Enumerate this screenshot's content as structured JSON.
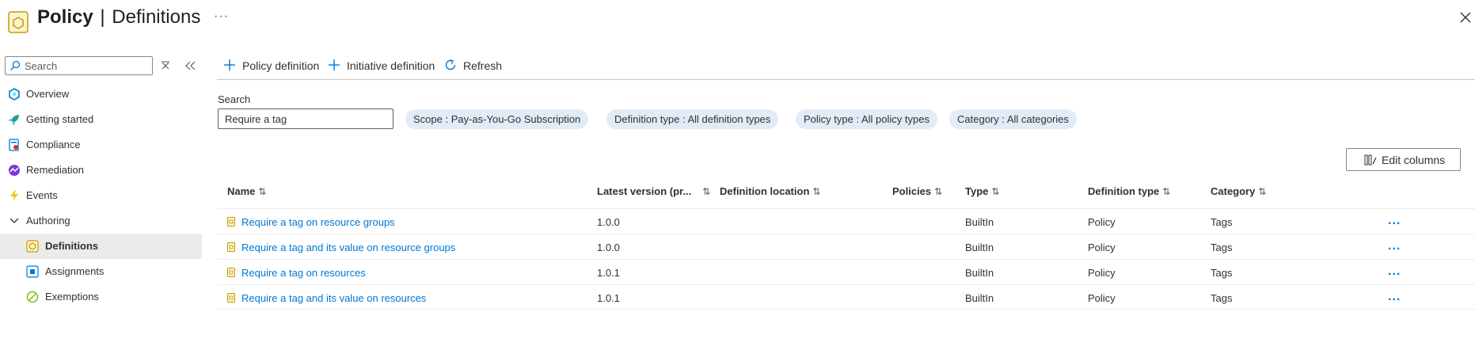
{
  "header": {
    "title_bold": "Policy",
    "separator": "|",
    "title_rest": "Definitions",
    "more": "···"
  },
  "sidebar": {
    "search_placeholder": "Search",
    "items": [
      {
        "label": "Overview",
        "icon": "overview-icon"
      },
      {
        "label": "Getting started",
        "icon": "rocket-icon"
      },
      {
        "label": "Compliance",
        "icon": "compliance-icon"
      },
      {
        "label": "Remediation",
        "icon": "remediation-icon"
      },
      {
        "label": "Events",
        "icon": "lightning-icon"
      },
      {
        "label": "Authoring",
        "icon": "chevron-down-icon"
      },
      {
        "label": "Definitions",
        "icon": "definitions-icon"
      },
      {
        "label": "Assignments",
        "icon": "assignments-icon"
      },
      {
        "label": "Exemptions",
        "icon": "exemptions-icon"
      }
    ]
  },
  "toolbar": {
    "policy_definition": "Policy definition",
    "initiative_definition": "Initiative definition",
    "refresh": "Refresh"
  },
  "filters": {
    "search_label": "Search",
    "search_value": "Require a tag",
    "scope": "Scope : Pay-as-You-Go Subscription",
    "definition_type": "Definition type : All definition types",
    "policy_type": "Policy type : All policy types",
    "category": "Category : All categories"
  },
  "edit_columns": "Edit columns",
  "table": {
    "columns": [
      "Name",
      "Latest version (pr...",
      "Definition location",
      "Policies",
      "Type",
      "Definition type",
      "Category"
    ],
    "sort_glyph": "⇅",
    "more_glyph": "...",
    "rows": [
      {
        "name": "Require a tag on resource groups",
        "version": "1.0.0",
        "location": "",
        "policies": "",
        "type": "BuiltIn",
        "definition_type": "Policy",
        "category": "Tags"
      },
      {
        "name": "Require a tag and its value on resource groups",
        "version": "1.0.0",
        "location": "",
        "policies": "",
        "type": "BuiltIn",
        "definition_type": "Policy",
        "category": "Tags"
      },
      {
        "name": "Require a tag on resources",
        "version": "1.0.1",
        "location": "",
        "policies": "",
        "type": "BuiltIn",
        "definition_type": "Policy",
        "category": "Tags"
      },
      {
        "name": "Require a tag and its value on resources",
        "version": "1.0.1",
        "location": "",
        "policies": "",
        "type": "BuiltIn",
        "definition_type": "Policy",
        "category": "Tags"
      }
    ]
  },
  "colors": {
    "accent": "#0078d4",
    "pill_bg": "#e1ecf7",
    "selected_bg": "#edebe9",
    "policy_icon": "#c19c00"
  }
}
